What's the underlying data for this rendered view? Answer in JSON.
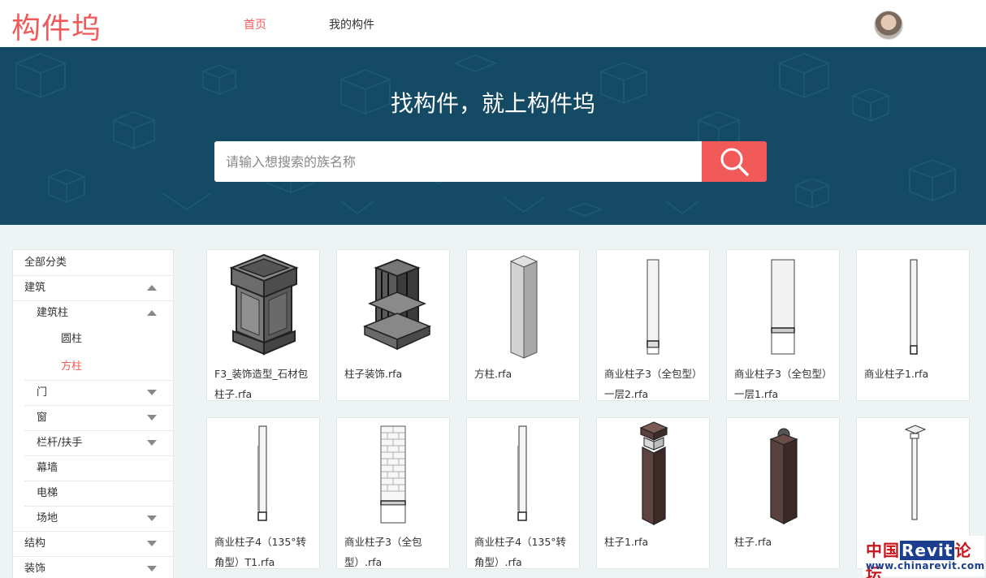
{
  "header": {
    "logo": "构件坞",
    "nav": [
      "首页",
      "我的构件"
    ]
  },
  "banner": {
    "title": "找构件，就上构件坞",
    "search_placeholder": "请输入想搜索的族名称"
  },
  "sidebar": {
    "all": "全部分类",
    "items": [
      {
        "label": "建筑",
        "arrow": "up"
      },
      {
        "label": "建筑柱",
        "arrow": "up"
      },
      {
        "label": "圆柱"
      },
      {
        "label": "方柱",
        "active": true
      },
      {
        "label": "门",
        "arrow": "down"
      },
      {
        "label": "窗",
        "arrow": "down"
      },
      {
        "label": "栏杆/扶手",
        "arrow": "down"
      },
      {
        "label": "幕墙"
      },
      {
        "label": "电梯"
      },
      {
        "label": "场地",
        "arrow": "down"
      },
      {
        "label": "结构",
        "arrow": "down"
      },
      {
        "label": "装饰",
        "arrow": "down"
      }
    ]
  },
  "cards": [
    {
      "name": "F3_装饰造型_石材包柱子.rfa",
      "icon": "stone-column-icon"
    },
    {
      "name": "柱子装饰.rfa",
      "icon": "decorated-column-icon"
    },
    {
      "name": "方柱.rfa",
      "icon": "square-column-icon"
    },
    {
      "name": "商业柱子3（全包型）一层2.rfa",
      "icon": "slim-column-icon"
    },
    {
      "name": "商业柱子3（全包型）一层1.rfa",
      "icon": "wide-column-icon"
    },
    {
      "name": "商业柱子1.rfa",
      "icon": "thin-column-icon"
    },
    {
      "name": "商业柱子4（135°转角型）T1.rfa",
      "icon": "corner-column-icon"
    },
    {
      "name": "商业柱子3（全包型）.rfa",
      "icon": "brick-column-icon"
    },
    {
      "name": "商业柱子4（135°转角型）.rfa",
      "icon": "corner-column-icon"
    },
    {
      "name": "柱子1.rfa",
      "icon": "capped-post-icon"
    },
    {
      "name": "柱子.rfa",
      "icon": "ball-post-icon"
    },
    {
      "name": "",
      "icon": "tall-pilaster-icon"
    }
  ],
  "watermark": {
    "line1_a": "中国",
    "line1_b": "Revit",
    "line1_c": "论坛",
    "line2": "www.chinarevit.com"
  },
  "colors": {
    "accent": "#f25a5a",
    "banner": "#144a63"
  }
}
